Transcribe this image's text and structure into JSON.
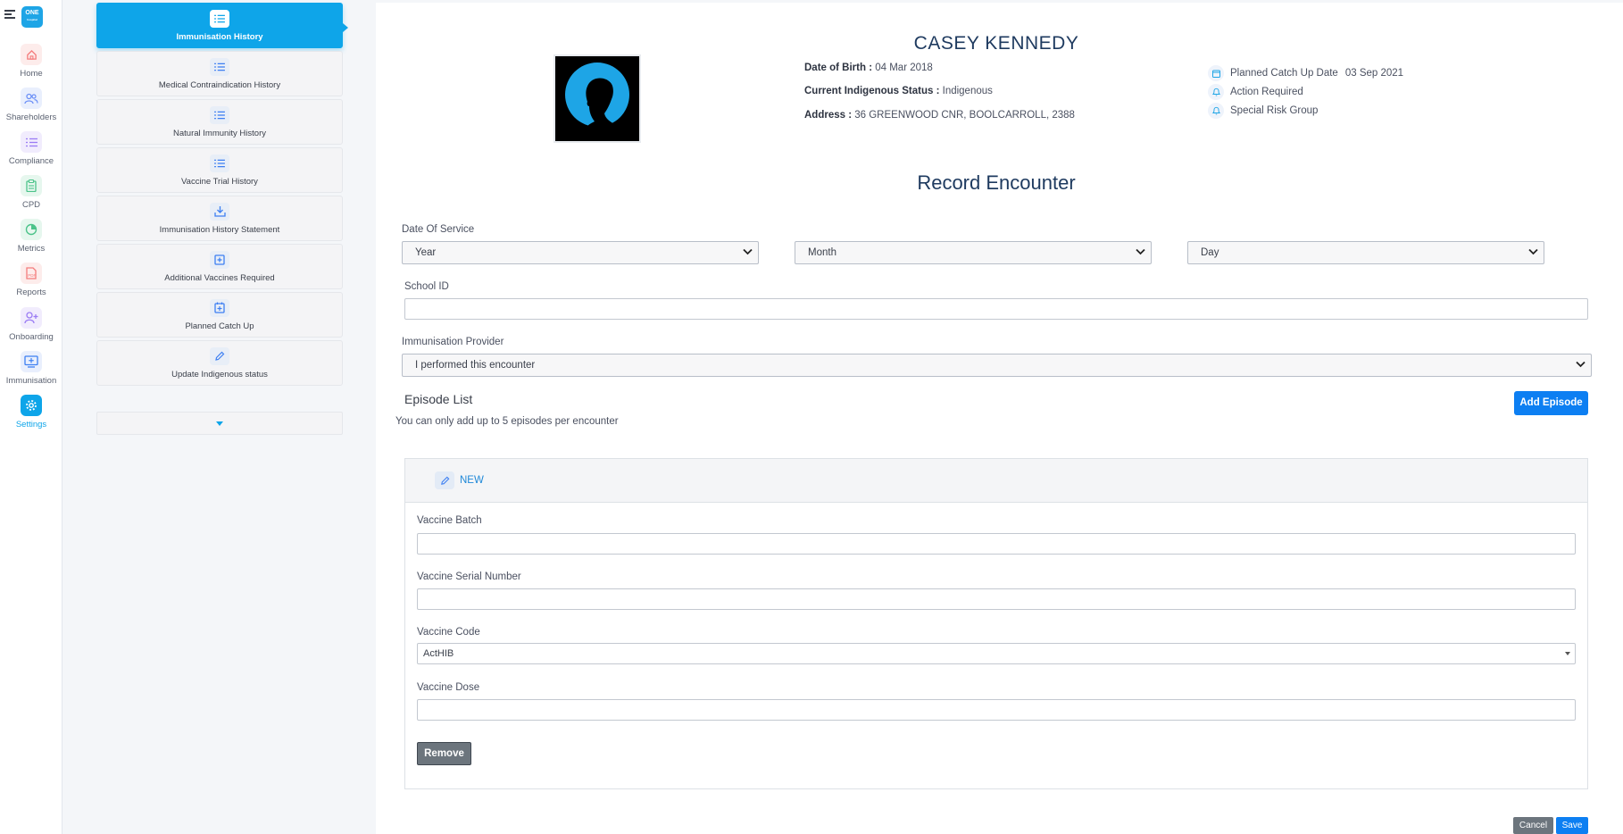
{
  "nav": {
    "logo_text": "ONE",
    "logo_sub": "hospital",
    "items": [
      {
        "label": "Home",
        "icon": "home-icon",
        "color": "#f47c7c"
      },
      {
        "label": "Shareholders",
        "icon": "users-icon",
        "color": "#6b8ff7"
      },
      {
        "label": "Compliance",
        "icon": "list-icon",
        "color": "#9b7cf4"
      },
      {
        "label": "CPD",
        "icon": "clipboard-icon",
        "color": "#4cc38a"
      },
      {
        "label": "Metrics",
        "icon": "pie-chart-icon",
        "color": "#4cc38a"
      },
      {
        "label": "Reports",
        "icon": "pdf-file-icon",
        "color": "#f47c7c"
      },
      {
        "label": "Onboarding",
        "icon": "user-plus-icon",
        "color": "#9b7cf4"
      },
      {
        "label": "Immunisation",
        "icon": "monitor-plus-icon",
        "color": "#3d7ff2"
      },
      {
        "label": "Settings",
        "icon": "gear-icon",
        "color": "#0ea5e9",
        "active": true
      }
    ]
  },
  "menu": {
    "items": [
      {
        "label": "Immunisation History",
        "icon": "list-icon",
        "active": true
      },
      {
        "label": "Medical Contraindication History",
        "icon": "list-icon"
      },
      {
        "label": "Natural Immunity History",
        "icon": "list-icon"
      },
      {
        "label": "Vaccine Trial History",
        "icon": "list-icon"
      },
      {
        "label": "Immunisation History Statement",
        "icon": "download-tray-icon"
      },
      {
        "label": "Additional Vaccines Required",
        "icon": "plus-square-icon"
      },
      {
        "label": "Planned Catch Up",
        "icon": "calendar-plus-icon"
      },
      {
        "label": "Update Indigenous status",
        "icon": "pencil-icon"
      }
    ],
    "expand_icon": "caret-down-icon"
  },
  "patient": {
    "name": "CASEY KENNEDY",
    "dob_label": "Date of Birth :",
    "dob": "04 Mar 2018",
    "indigenous_label": "Current Indigenous Status :",
    "indigenous": "Indigenous",
    "address_label": "Address :",
    "address": "36 GREENWOOD CNR, BOOLCARROLL, 2388",
    "catchup_label": "Planned Catch Up Date",
    "catchup_date": "03 Sep 2021",
    "action_required": "Action Required",
    "special_risk": "Special Risk Group"
  },
  "form": {
    "title": "Record Encounter",
    "date_label": "Date Of Service",
    "year": "Year",
    "month": "Month",
    "day": "Day",
    "school_label": "School ID",
    "school_value": "",
    "provider_label": "Immunisation Provider",
    "provider": "I performed this encounter",
    "episode_title": "Episode List",
    "episode_note": "You can only add up to 5 episodes per encounter",
    "add_episode": "Add Episode",
    "cancel": "Cancel",
    "save": "Save"
  },
  "episode": {
    "status": "NEW",
    "batch_label": "Vaccine Batch",
    "batch_value": "",
    "serial_label": "Vaccine Serial Number",
    "serial_value": "",
    "code_label": "Vaccine Code",
    "code": "ActHIB",
    "dose_label": "Vaccine Dose",
    "dose_value": "",
    "remove": "Remove"
  }
}
